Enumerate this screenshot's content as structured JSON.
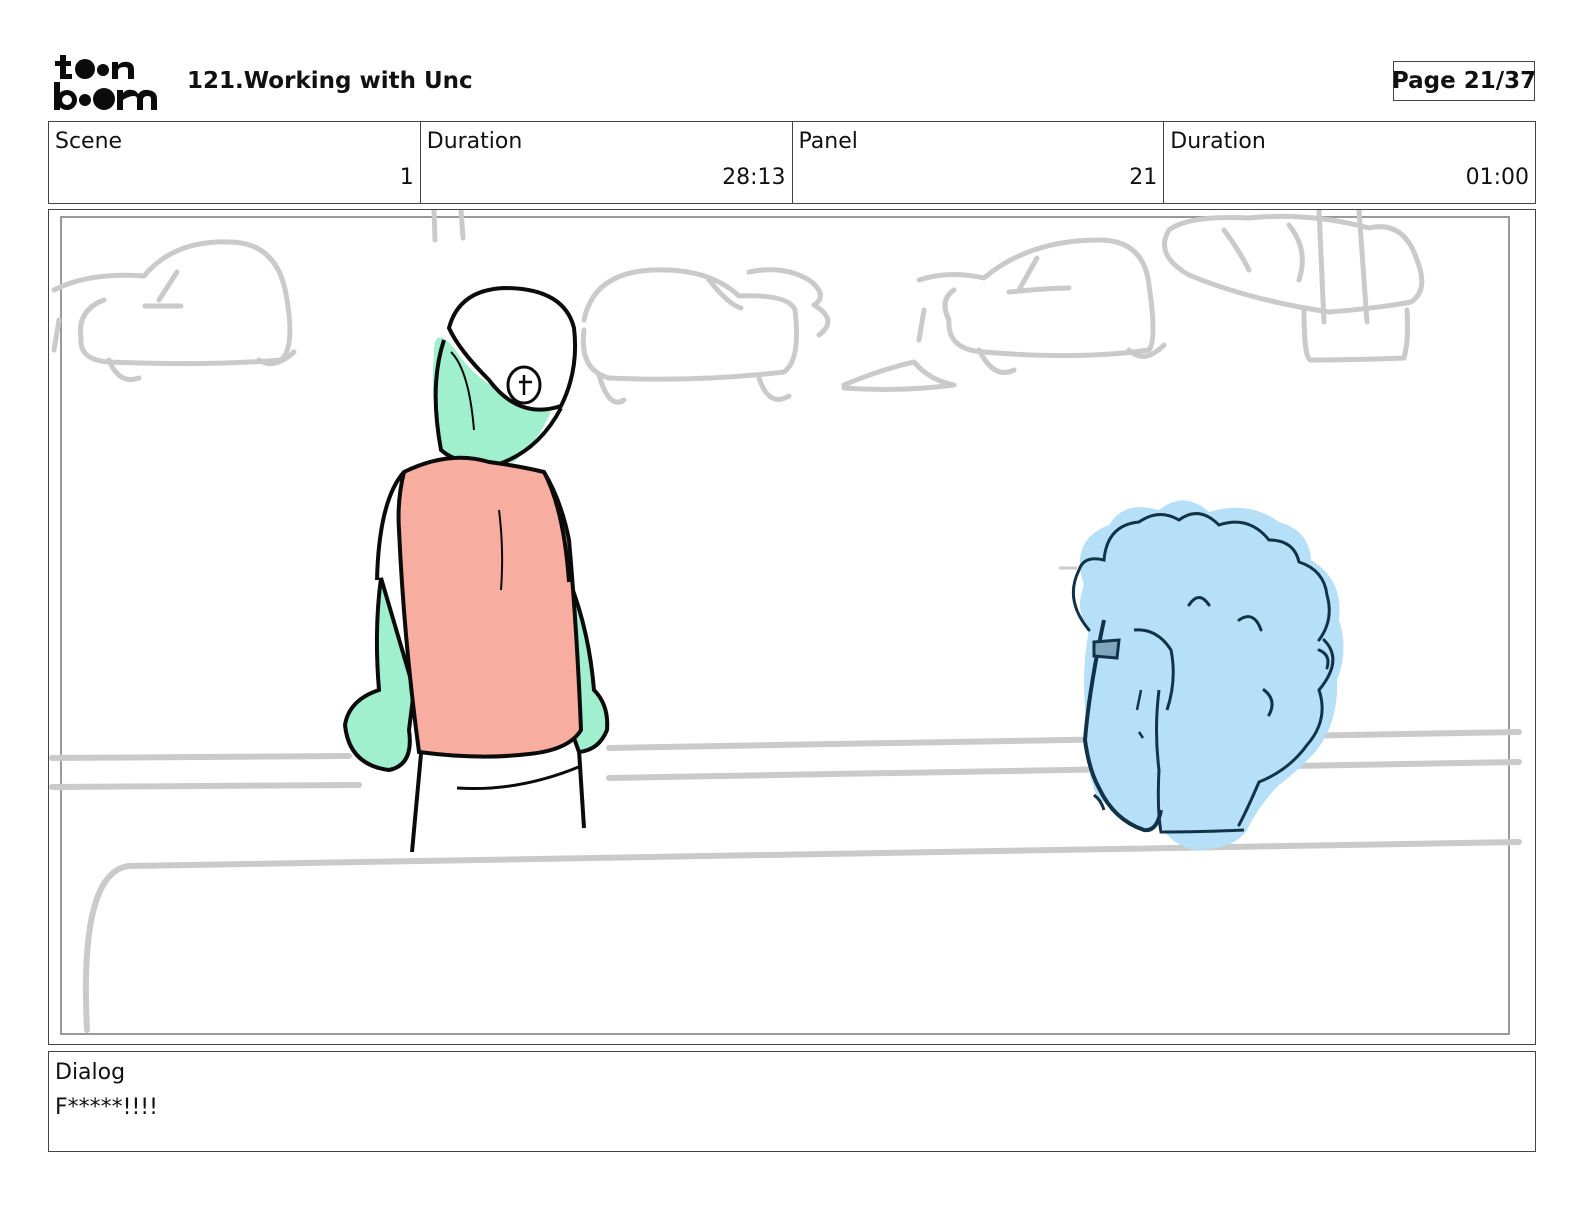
{
  "header": {
    "logo_text": "toon boom",
    "title": "121.Working with Unc",
    "page_label": "Page 21/37"
  },
  "info": [
    {
      "label": "Scene",
      "value": "1"
    },
    {
      "label": "Duration",
      "value": "28:13"
    },
    {
      "label": "Panel",
      "value": "21"
    },
    {
      "label": "Duration",
      "value": "01:00"
    }
  ],
  "panel": {
    "description_colors": {
      "sketch_gray": "#c8c8c8",
      "character_green": "#9ff0cf",
      "shirt_red": "#f8ada0",
      "hair_blue": "#b6e0f7",
      "outline": "#0b0b0b"
    }
  },
  "dialog": {
    "label": "Dialog",
    "text": "F*****!!!!"
  }
}
